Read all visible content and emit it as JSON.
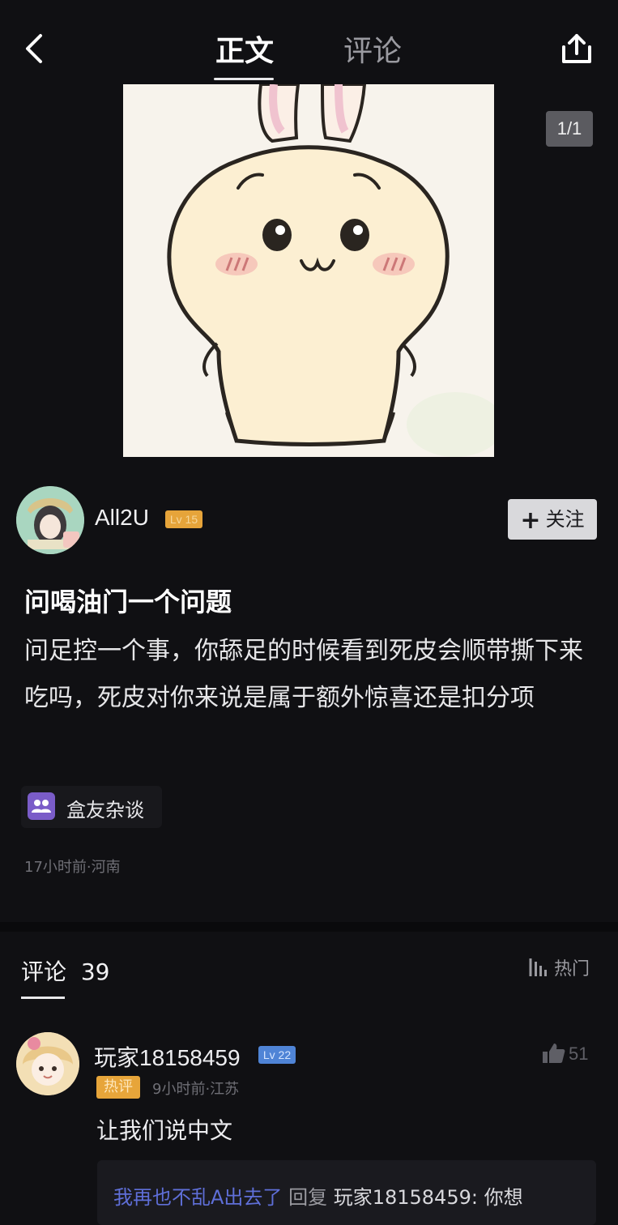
{
  "topbar": {
    "tabs": [
      {
        "label": "正文",
        "active": true
      },
      {
        "label": "评论",
        "active": false
      }
    ]
  },
  "post": {
    "page_counter": "1/1",
    "author": {
      "name": "All2U",
      "level": "Lv 15"
    },
    "follow_label": "关注",
    "title": "问喝油门一个问题",
    "body": "问足控一个事，你舔足的时候看到死皮会顺带撕下来吃吗，死皮对你来说是属于额外惊喜还是扣分项",
    "tag": "盒友杂谈",
    "meta": "17小时前·河南"
  },
  "comments": {
    "header": "评论",
    "count": "39",
    "sort_label": "热门",
    "items": [
      {
        "user": "玩家18158459",
        "level": "Lv 22",
        "badge": "热评",
        "meta": "9小时前·江苏",
        "text": "让我们说中文",
        "likes": "51",
        "reply": {
          "user": "我再也不乱A出去了",
          "word": "回复",
          "target": "玩家18158459:",
          "text": "你想"
        }
      }
    ]
  },
  "colors": {
    "background": "#101013",
    "author_level": "#e6a43a",
    "comment_level": "#4f84d6",
    "hot_badge": "#e7a53a",
    "tag_icon": "#7a5cc8",
    "reply_user": "#5f6fd8"
  },
  "icons": {
    "back": "chevron-left-icon",
    "share": "share-icon",
    "follow": "plus-icon",
    "tag": "users-icon",
    "sort": "sort-icon",
    "like": "thumbs-up-icon"
  }
}
